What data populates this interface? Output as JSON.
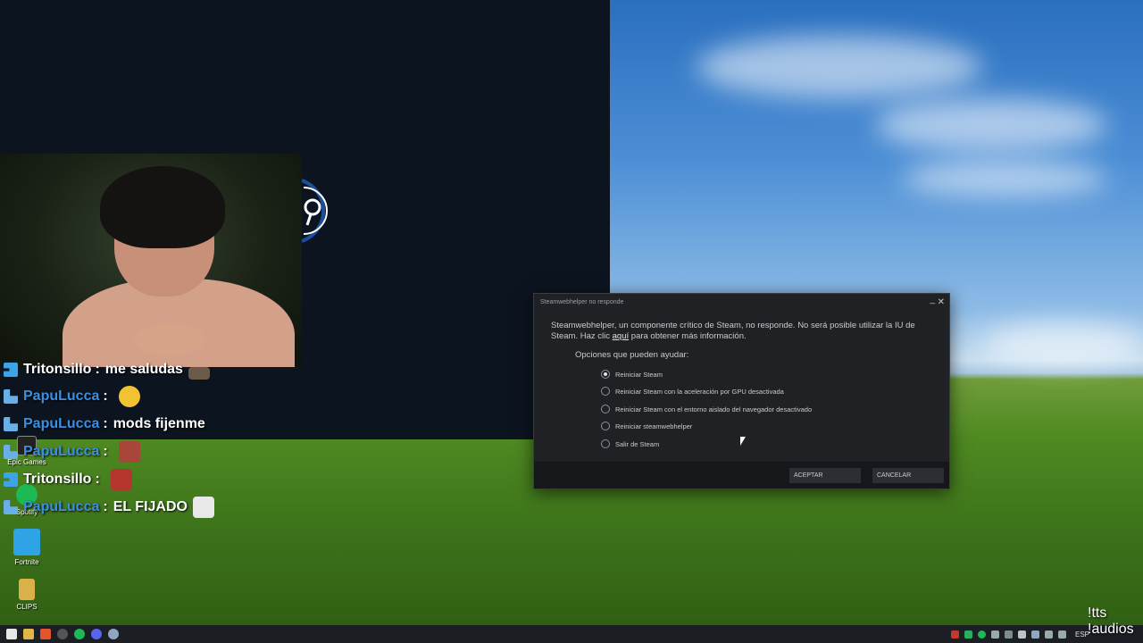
{
  "dialog": {
    "title": "Steamwebhelper no responde",
    "minimize_label": "_",
    "close_label": "✕",
    "message_part1": "Steamwebhelper, un componente crítico de Steam, no responde. No será posible utilizar la IU de Steam. Haz clic ",
    "message_link": "aquí",
    "message_part2": " para obtener más información.",
    "options_label": "Opciones que pueden ayudar:",
    "options": [
      {
        "label": "Reiniciar Steam",
        "checked": true
      },
      {
        "label": "Reiniciar Steam con la aceleración por GPU desactivada",
        "checked": false
      },
      {
        "label": "Reiniciar Steam con el entorno aislado del navegador desactivado",
        "checked": false
      },
      {
        "label": "Reiniciar steamwebhelper",
        "checked": false
      },
      {
        "label": "Salir de Steam",
        "checked": false
      }
    ],
    "accept_label": "ACEPTAR",
    "cancel_label": "CANCELAR"
  },
  "chat": [
    {
      "user": "Tritonsillo",
      "sep": ":",
      "message": "me saludas",
      "color": "#ffffff",
      "badge": "b1"
    },
    {
      "user": "PapuLucca",
      "sep": ":",
      "message": "",
      "color": "#3b8fe0",
      "badge": "b2"
    },
    {
      "user": "PapuLucca",
      "sep": ":",
      "message": "mods fijenme",
      "color": "#3b8fe0",
      "badge": "b2"
    },
    {
      "user": "PapuLucca",
      "sep": ":",
      "message": "",
      "color": "#3b8fe0",
      "badge": "b2"
    },
    {
      "user": "Tritonsillo",
      "sep": ":",
      "message": "",
      "color": "#ffffff",
      "badge": "b1"
    },
    {
      "user": "PapuLucca",
      "sep": ":",
      "message": "EL FIJADO",
      "color": "#3b8fe0",
      "badge": "b2"
    }
  ],
  "desktop_icons": [
    {
      "label": "Epic Games",
      "icon": "epic-games-icon"
    },
    {
      "label": "Spotify",
      "icon": "spotify-icon"
    },
    {
      "label": "Fortnite",
      "icon": "fortnite-icon"
    },
    {
      "label": "CLIPS",
      "icon": "folder-icon"
    }
  ],
  "taskbar": {
    "language": "ESP"
  },
  "overlay": {
    "line1": "!tts",
    "line2": "!audios"
  },
  "colors": {
    "steam_splash": "#0c1420",
    "dialog_bg": "#202124",
    "accent_blue": "#3b8fe0"
  }
}
